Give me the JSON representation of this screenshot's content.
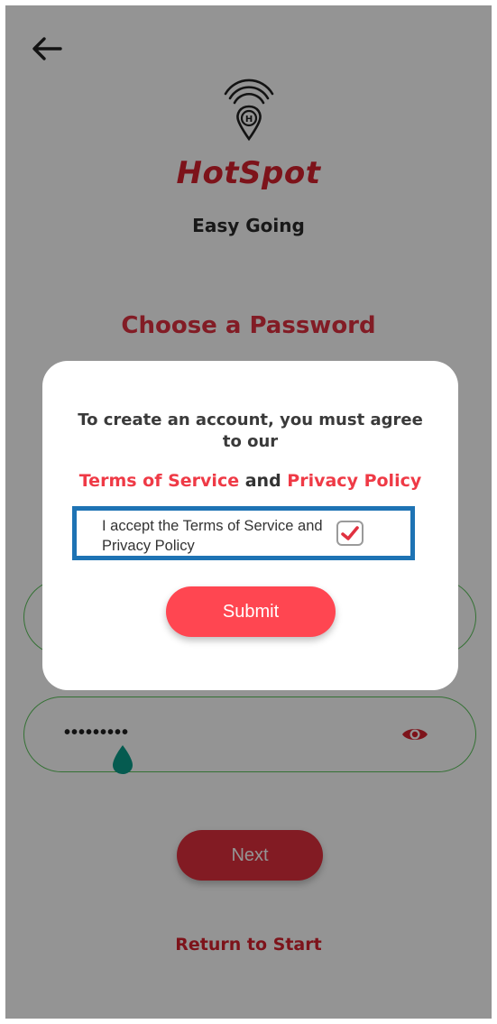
{
  "brand": {
    "title": "HotSpot",
    "tagline": "Easy Going",
    "logo_icon": "hotspot-location-pin-icon"
  },
  "page": {
    "title": "Choose a Password"
  },
  "form": {
    "password_value": "•••••••••",
    "confirm_value": "",
    "eye_icon": "eye-icon"
  },
  "actions": {
    "next_label": "Next",
    "return_label": "Return to Start"
  },
  "dialog": {
    "message": "To create an account, you must agree to our",
    "terms_label": "Terms of Service",
    "and_label": "and",
    "privacy_label": "Privacy Policy",
    "accept_label": "I accept the Terms of Service and Privacy Policy",
    "accept_checked": true,
    "submit_label": "Submit"
  },
  "colors": {
    "brand_red": "#d8222e",
    "link_red": "#ef3a46",
    "button_red": "#ff4651",
    "field_border": "#5ac35a",
    "highlight_border": "#1e73b4",
    "cursor_handle": "#0a9e8a"
  }
}
